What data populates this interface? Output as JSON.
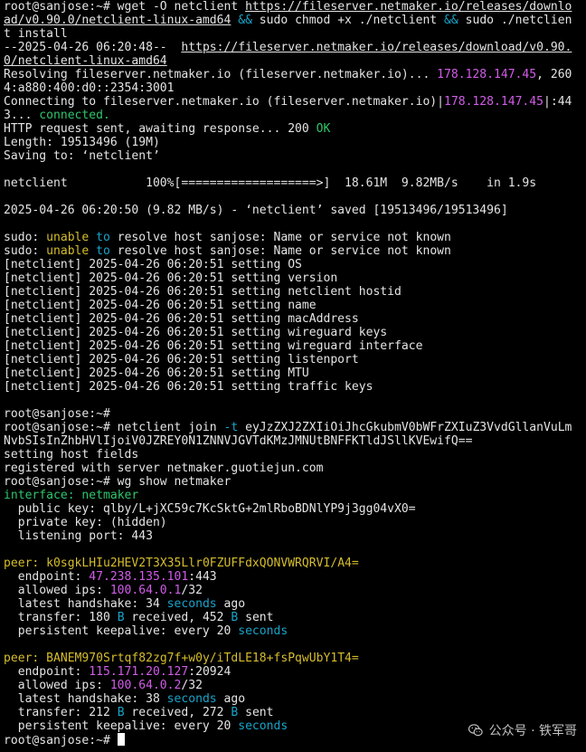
{
  "colors": {
    "default": "#e4e4e4",
    "cyan": "#1aa3c9",
    "magenta": "#d15ce8",
    "green": "#2fc56b",
    "yellow": "#d5bd2c",
    "background": "#000000",
    "cursor": "#ffffff"
  },
  "terminal": {
    "lines": [
      [
        {
          "t": "root@sanjose:~# wget -O netclient "
        },
        {
          "t": "https://fileserver.netmaker.io/releases/downlo",
          "u": true
        }
      ],
      [
        {
          "t": "ad/v0.90.0/netclient-linux-amd64",
          "u": true
        },
        {
          "t": " "
        },
        {
          "t": "&&",
          "c": "cyan"
        },
        {
          "t": " sudo chmod +x ./netclient "
        },
        {
          "t": "&&",
          "c": "cyan"
        },
        {
          "t": " sudo ./netclien"
        }
      ],
      [
        {
          "t": "t install"
        }
      ],
      [
        {
          "t": "--2025-04-26 06:20:48--  "
        },
        {
          "t": "https://fileserver.netmaker.io/releases/download/v0.90.",
          "u": true
        }
      ],
      [
        {
          "t": "0/netclient-linux-amd64",
          "u": true
        }
      ],
      [
        {
          "t": "Resolving fileserver.netmaker.io (fileserver.netmaker.io)... "
        },
        {
          "t": "178.128.147.45",
          "c": "magenta"
        },
        {
          "t": ", 260"
        }
      ],
      [
        {
          "t": "4:a880:400:d0::2354:3001"
        }
      ],
      [
        {
          "t": "Connecting to fileserver.netmaker.io (fileserver.netmaker.io)|"
        },
        {
          "t": "178.128.147.45",
          "c": "magenta"
        },
        {
          "t": "|:44"
        }
      ],
      [
        {
          "t": "3... "
        },
        {
          "t": "connected.",
          "c": "green"
        }
      ],
      [
        {
          "t": "HTTP request sent, awaiting response... 200 "
        },
        {
          "t": "OK",
          "c": "green"
        }
      ],
      [
        {
          "t": "Length: 19513496 (19M)"
        }
      ],
      [
        {
          "t": "Saving to: ‘netclient’"
        }
      ],
      [
        {
          "t": ""
        }
      ],
      [
        {
          "t": "netclient           100%[===================>]  18.61M  9.82MB/s    in 1.9s"
        }
      ],
      [
        {
          "t": ""
        }
      ],
      [
        {
          "t": "2025-04-26 06:20:50 (9.82 MB/s) - ‘netclient’ saved [19513496/19513496]"
        }
      ],
      [
        {
          "t": ""
        }
      ],
      [
        {
          "t": "sudo: "
        },
        {
          "t": "unable",
          "c": "yellow"
        },
        {
          "t": " "
        },
        {
          "t": "to",
          "c": "cyan"
        },
        {
          "t": " resolve host sanjose: Name or service not known"
        }
      ],
      [
        {
          "t": "sudo: "
        },
        {
          "t": "unable",
          "c": "yellow"
        },
        {
          "t": " "
        },
        {
          "t": "to",
          "c": "cyan"
        },
        {
          "t": " resolve host sanjose: Name or service not known"
        }
      ],
      [
        {
          "t": "[netclient] 2025-04-26 06:20:51 setting OS"
        }
      ],
      [
        {
          "t": "[netclient] 2025-04-26 06:20:51 setting version"
        }
      ],
      [
        {
          "t": "[netclient] 2025-04-26 06:20:51 setting netclient hostid"
        }
      ],
      [
        {
          "t": "[netclient] 2025-04-26 06:20:51 setting name"
        }
      ],
      [
        {
          "t": "[netclient] 2025-04-26 06:20:51 setting macAddress"
        }
      ],
      [
        {
          "t": "[netclient] 2025-04-26 06:20:51 setting wireguard keys"
        }
      ],
      [
        {
          "t": "[netclient] 2025-04-26 06:20:51 setting wireguard interface"
        }
      ],
      [
        {
          "t": "[netclient] 2025-04-26 06:20:51 setting listenport"
        }
      ],
      [
        {
          "t": "[netclient] 2025-04-26 06:20:51 setting MTU"
        }
      ],
      [
        {
          "t": "[netclient] 2025-04-26 06:20:51 setting traffic keys"
        }
      ],
      [
        {
          "t": ""
        }
      ],
      [
        {
          "t": "root@sanjose:~#"
        }
      ],
      [
        {
          "t": "root@sanjose:~# netclient join "
        },
        {
          "t": "-t",
          "c": "cyan"
        },
        {
          "t": " eyJzZXJ2ZXIiOiJhcGkubmV0bWFrZXIuZ3VvdGllanVuLm"
        }
      ],
      [
        {
          "t": "NvbSIsInZhbHVlIjoiV0JZREY0N1ZNNVJGVTdKMzJMNUtBNFFKTldJSllKVEwifQ=="
        }
      ],
      [
        {
          "t": "setting host fields"
        }
      ],
      [
        {
          "t": "registered with server netmaker.guotiejun.com"
        }
      ],
      [
        {
          "t": "root@sanjose:~# wg show netmaker"
        }
      ],
      [
        {
          "t": "interface:",
          "c": "green"
        },
        {
          "t": " "
        },
        {
          "t": "netmaker",
          "c": "green"
        }
      ],
      [
        {
          "t": "  public key: qlby/L+jXC59c7KcSktG+2mlRboBDNlYP9j3gg04vX0="
        }
      ],
      [
        {
          "t": "  private key: (hidden)"
        }
      ],
      [
        {
          "t": "  listening port: 443"
        }
      ],
      [
        {
          "t": ""
        }
      ],
      [
        {
          "t": "peer:",
          "c": "yellow"
        },
        {
          "t": " "
        },
        {
          "t": "k0sgkLHIu2HEV2T3X35Llr0FZUFFdxQONVWRQRVI/A4=",
          "c": "yellow"
        }
      ],
      [
        {
          "t": "  endpoint: "
        },
        {
          "t": "47.238.135.101",
          "c": "magenta"
        },
        {
          "t": ":443"
        }
      ],
      [
        {
          "t": "  allowed ips: "
        },
        {
          "t": "100.64.0.1",
          "c": "magenta"
        },
        {
          "t": "/32"
        }
      ],
      [
        {
          "t": "  latest handshake: 34 "
        },
        {
          "t": "seconds",
          "c": "cyan"
        },
        {
          "t": " ago"
        }
      ],
      [
        {
          "t": "  transfer: 180 "
        },
        {
          "t": "B",
          "c": "cyan"
        },
        {
          "t": " received, 452 "
        },
        {
          "t": "B",
          "c": "cyan"
        },
        {
          "t": " sent"
        }
      ],
      [
        {
          "t": "  persistent keepalive: every 20 "
        },
        {
          "t": "seconds",
          "c": "cyan"
        }
      ],
      [
        {
          "t": ""
        }
      ],
      [
        {
          "t": "peer:",
          "c": "yellow"
        },
        {
          "t": " "
        },
        {
          "t": "BANEM970Srtqf82zg7f+w0y/iTdLE18+fsPqwUbY1T4=",
          "c": "yellow"
        }
      ],
      [
        {
          "t": "  endpoint: "
        },
        {
          "t": "115.171.20.127",
          "c": "magenta"
        },
        {
          "t": ":20924"
        }
      ],
      [
        {
          "t": "  allowed ips: "
        },
        {
          "t": "100.64.0.2",
          "c": "magenta"
        },
        {
          "t": "/32"
        }
      ],
      [
        {
          "t": "  latest handshake: 38 "
        },
        {
          "t": "seconds",
          "c": "cyan"
        },
        {
          "t": " ago"
        }
      ],
      [
        {
          "t": "  transfer: 212 "
        },
        {
          "t": "B",
          "c": "cyan"
        },
        {
          "t": " received, 272 "
        },
        {
          "t": "B",
          "c": "cyan"
        },
        {
          "t": " sent"
        }
      ],
      [
        {
          "t": "  persistent keepalive: every 20 "
        },
        {
          "t": "seconds",
          "c": "cyan"
        }
      ],
      [
        {
          "t": "root@sanjose:~# ",
          "cursor": true
        }
      ]
    ]
  },
  "watermark": {
    "icon": "wechat-icon",
    "text": "公众号 · 铁军哥"
  }
}
